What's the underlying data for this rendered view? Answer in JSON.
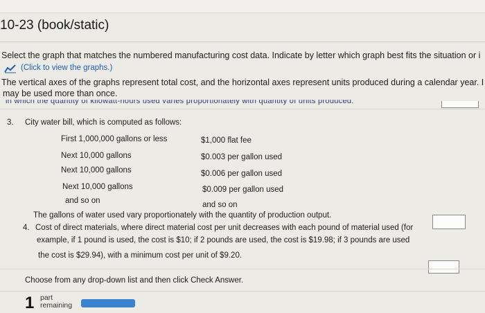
{
  "header": {
    "title": "10-23 (book/static)"
  },
  "instructions": {
    "line1": "Select the graph that matches the numbered manufacturing cost data. Indicate by letter which graph best fits the situation or i",
    "graph_link": "(Click to view the graphs.)",
    "line2": "The vertical axes of the graphs represent total cost, and the horizontal axes represent units produced during a calendar year. I",
    "line3": "may be used more than once.",
    "cut_off": "in which the quantity of kilowatt-hours used varies proportionately with quantity of units produced."
  },
  "item3": {
    "number": "3.",
    "intro": "City water bill, which is computed as follows:",
    "rows": [
      {
        "tier": "First 1,000,000 gallons or less",
        "rate": "$1,000 flat fee"
      },
      {
        "tier": "Next 10,000 gallons",
        "rate": "$0.003 per gallon used"
      },
      {
        "tier": "Next 10,000 gallons",
        "rate": "$0.006 per gallon used"
      },
      {
        "tier": "Next 10,000 gallons",
        "rate": "$0.009 per gallon used"
      },
      {
        "tier": "and so on",
        "rate": "and so on"
      }
    ],
    "note": "The gallons of water used vary proportionately with the quantity of production output."
  },
  "item4": {
    "number": "4.",
    "line1": "Cost of direct materials, where direct material cost per unit decreases with each pound of material used (for",
    "line2": "example, if 1 pound is used, the cost is $10; if 2 pounds are used, the cost is $19.98; if 3 pounds are used",
    "line3": "the cost is $29.94), with a minimum cost per unit of $9.20."
  },
  "footer": {
    "instruction": "Choose from any drop-down list and then click Check Answer.",
    "remaining_count": "1",
    "remaining_label_1": "part",
    "remaining_label_2": "remaining",
    "progress": 1.0
  },
  "colors": {
    "accent_link": "#1f5fb4",
    "progress": "#3a83cf"
  },
  "icons": {
    "graph": "line-chart-icon"
  }
}
